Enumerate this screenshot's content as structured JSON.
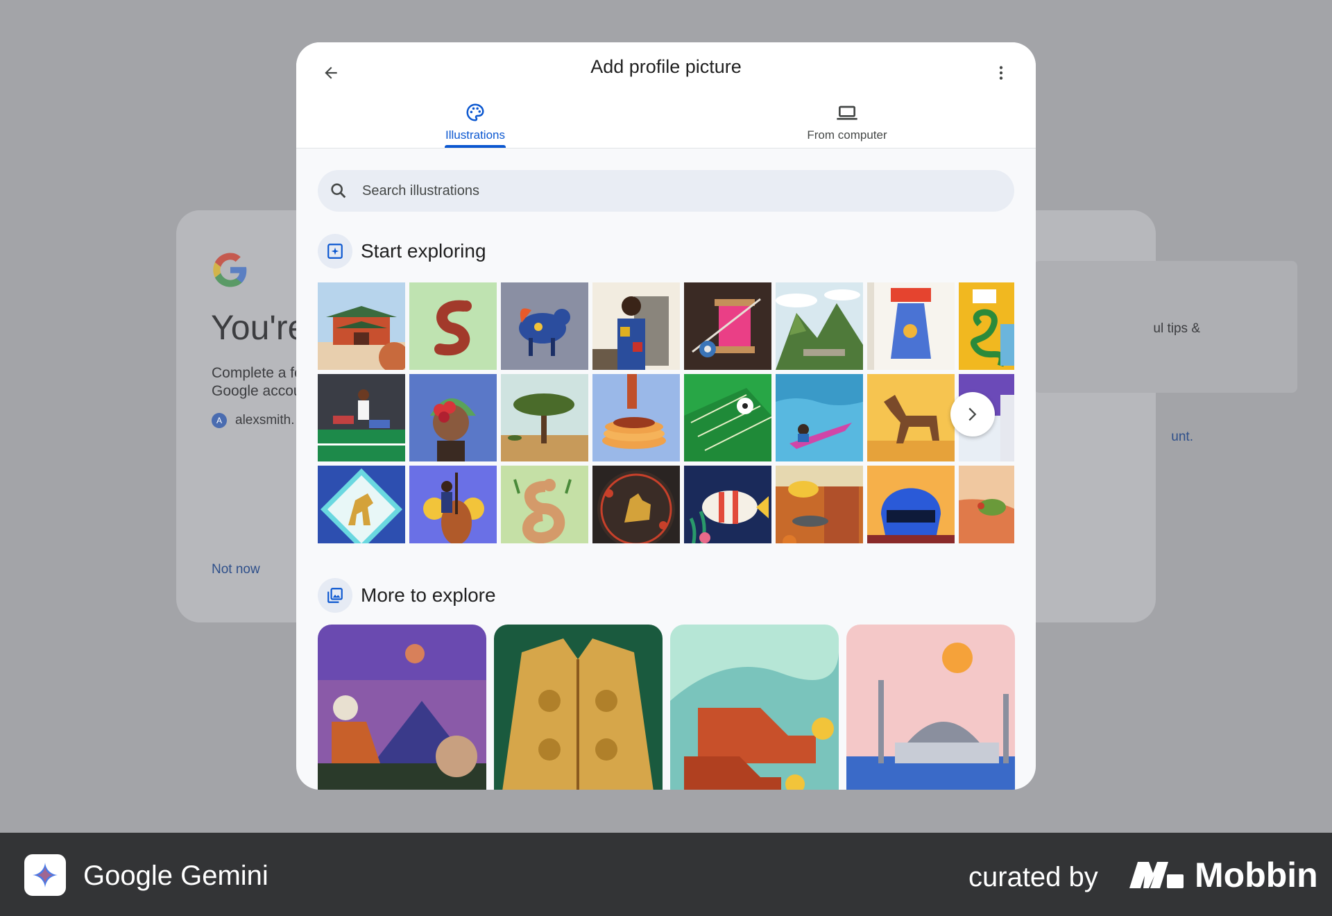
{
  "background": {
    "title": "You're",
    "description": "Complete a fe Google accou",
    "account_initial": "A",
    "account": "alexsmith.",
    "not_now": "Not now",
    "side_text": "ul tips &",
    "side_link": "unt."
  },
  "dialog": {
    "title": "Add profile picture",
    "tabs": [
      {
        "label": "Illustrations",
        "selected": true,
        "icon": "palette-icon"
      },
      {
        "label": "From computer",
        "selected": false,
        "icon": "laptop-icon"
      }
    ],
    "search": {
      "placeholder": "Search illustrations"
    },
    "sections": {
      "start": {
        "label": "Start exploring"
      },
      "more": {
        "label": "More to explore"
      }
    },
    "accent_color": "#0b57d0"
  },
  "footer": {
    "app_name": "Google Gemini",
    "curated_by": "curated by",
    "brand": "Mobbin"
  }
}
